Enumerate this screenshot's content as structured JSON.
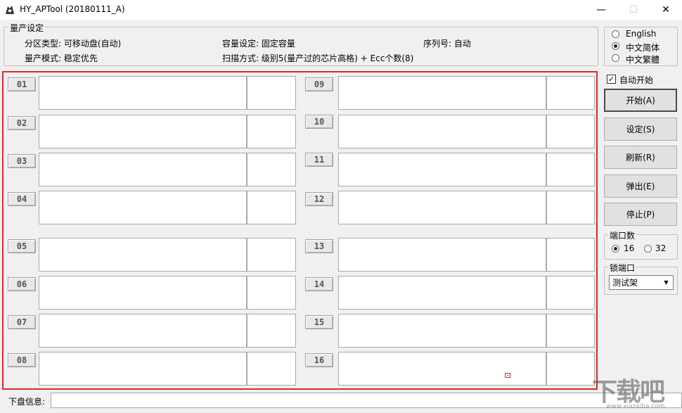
{
  "window": {
    "title": "HY_APTool (20180111_A)",
    "min_glyph": "—",
    "max_glyph": "☐",
    "close_glyph": "✕"
  },
  "settings": {
    "group_label": "量产设定",
    "partition_type": "分区类型: 可移动盘(自动)",
    "capacity_setting": "容量设定: 固定容量",
    "serial_number": "序列号:  自动",
    "production_mode": "量产模式: 稳定优先",
    "scan_mode": "扫描方式: 级别5(量产过的芯片高格) + Ecc个数(8)"
  },
  "ports": [
    {
      "label": "01"
    },
    {
      "label": "02"
    },
    {
      "label": "03"
    },
    {
      "label": "04"
    },
    {
      "label": "05"
    },
    {
      "label": "06"
    },
    {
      "label": "07"
    },
    {
      "label": "08"
    },
    {
      "label": "09"
    },
    {
      "label": "10"
    },
    {
      "label": "11"
    },
    {
      "label": "12"
    },
    {
      "label": "13"
    },
    {
      "label": "14"
    },
    {
      "label": "15"
    },
    {
      "label": "16"
    }
  ],
  "language": {
    "options": [
      "English",
      "中文简体",
      "中文繁體"
    ],
    "selected": "中文简体"
  },
  "auto_start": {
    "label": "自动开始",
    "checked": true,
    "check_glyph": "✓"
  },
  "actions": {
    "start": "开始(A)",
    "settings": "设定(S)",
    "refresh": "刷新(R)",
    "eject": "弹出(E)",
    "stop": "停止(P)"
  },
  "port_count": {
    "group_label": "端口数",
    "options": [
      "16",
      "32"
    ],
    "selected": "16"
  },
  "lock_port": {
    "group_label": "锁端口",
    "value": "测试架",
    "arrow_glyph": "▼"
  },
  "bottom": {
    "label": "下盘信息:",
    "value": ""
  },
  "watermark": {
    "text": "下载吧",
    "url": "www.xiazaiba.com"
  },
  "colors": {
    "highlight_border": "#d92a2a"
  }
}
